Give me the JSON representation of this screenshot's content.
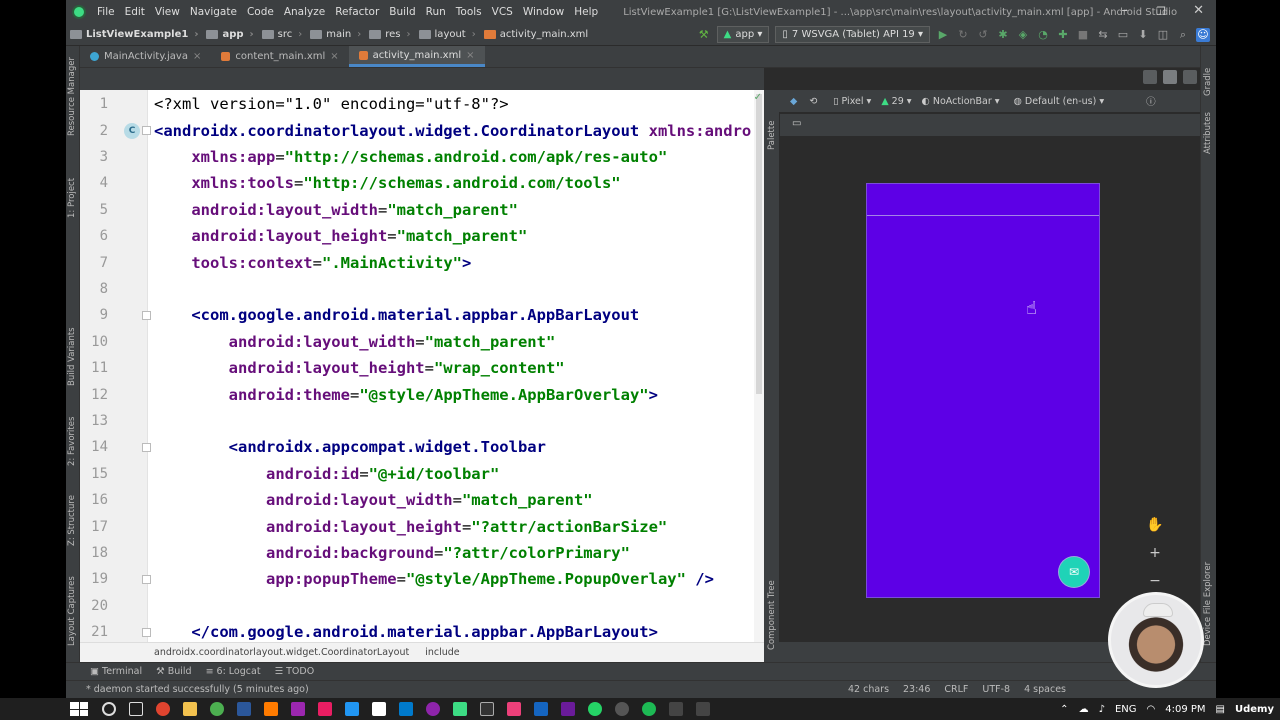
{
  "window": {
    "menu": [
      "File",
      "Edit",
      "View",
      "Navigate",
      "Code",
      "Analyze",
      "Refactor",
      "Build",
      "Run",
      "Tools",
      "VCS",
      "Window",
      "Help"
    ],
    "title": "ListViewExample1 [G:\\ListViewExample1] - ...\\app\\src\\main\\res\\layout\\activity_main.xml [app] - Android Studio",
    "controls": [
      "–",
      "❐",
      "✕"
    ]
  },
  "nav": {
    "breadcrumbs": [
      "ListViewExample1",
      "app",
      "src",
      "main",
      "res",
      "layout",
      "activity_main.xml"
    ],
    "run_config": "app",
    "device": "7  WSVGA (Tablet) API 19"
  },
  "tabs": [
    {
      "label": "MainActivity.java",
      "color": "#3ea6d3"
    },
    {
      "label": "content_main.xml",
      "color": "#e07b3a"
    },
    {
      "label": "activity_main.xml",
      "color": "#e07b3a",
      "active": true
    }
  ],
  "left_stripe": [
    "Resource Manager",
    "1: Project",
    "Build Variants",
    "2: Favorites",
    "Z: Structure",
    "Layout Captures"
  ],
  "right_stripe": [
    "Gradle",
    "Attributes",
    "Device File Explorer"
  ],
  "designer_stripe": [
    "Palette",
    "Component Tree"
  ],
  "code": [
    {
      "n": "1",
      "parts": [
        [
          "pi",
          "<?xml version=\"1.0\" encoding=\"utf-8\"?>"
        ]
      ]
    },
    {
      "n": "2",
      "mark": "C",
      "parts": [
        [
          "tag",
          "<androidx.coordinatorlayout.widget.CoordinatorLayout"
        ],
        [
          "pi",
          " "
        ],
        [
          "attr",
          "xmlns:andro"
        ]
      ]
    },
    {
      "n": "3",
      "parts": [
        [
          "pi",
          "    "
        ],
        [
          "attr",
          "xmlns:app"
        ],
        [
          "pi",
          "="
        ],
        [
          "val",
          "\"http://schemas.android.com/apk/res-auto\""
        ]
      ]
    },
    {
      "n": "4",
      "parts": [
        [
          "pi",
          "    "
        ],
        [
          "attr",
          "xmlns:tools"
        ],
        [
          "pi",
          "="
        ],
        [
          "val",
          "\"http://schemas.android.com/tools\""
        ]
      ]
    },
    {
      "n": "5",
      "parts": [
        [
          "pi",
          "    "
        ],
        [
          "attr",
          "android:layout_width"
        ],
        [
          "pi",
          "="
        ],
        [
          "val",
          "\"match_parent\""
        ]
      ]
    },
    {
      "n": "6",
      "parts": [
        [
          "pi",
          "    "
        ],
        [
          "attr",
          "android:layout_height"
        ],
        [
          "pi",
          "="
        ],
        [
          "val",
          "\"match_parent\""
        ]
      ]
    },
    {
      "n": "7",
      "parts": [
        [
          "pi",
          "    "
        ],
        [
          "attr",
          "tools:context"
        ],
        [
          "pi",
          "="
        ],
        [
          "val",
          "\".MainActivity\""
        ],
        [
          "tag",
          ">"
        ]
      ]
    },
    {
      "n": "8",
      "parts": []
    },
    {
      "n": "9",
      "parts": [
        [
          "pi",
          "    "
        ],
        [
          "tag",
          "<com.google.android.material.appbar.AppBarLayout"
        ]
      ]
    },
    {
      "n": "10",
      "parts": [
        [
          "pi",
          "        "
        ],
        [
          "attr",
          "android:layout_width"
        ],
        [
          "pi",
          "="
        ],
        [
          "val",
          "\"match_parent\""
        ]
      ]
    },
    {
      "n": "11",
      "parts": [
        [
          "pi",
          "        "
        ],
        [
          "attr",
          "android:layout_height"
        ],
        [
          "pi",
          "="
        ],
        [
          "val",
          "\"wrap_content\""
        ]
      ]
    },
    {
      "n": "12",
      "parts": [
        [
          "pi",
          "        "
        ],
        [
          "attr",
          "android:theme"
        ],
        [
          "pi",
          "="
        ],
        [
          "val",
          "\"@style/AppTheme.AppBarOverlay\""
        ],
        [
          "tag",
          ">"
        ]
      ]
    },
    {
      "n": "13",
      "parts": []
    },
    {
      "n": "14",
      "parts": [
        [
          "pi",
          "        "
        ],
        [
          "tag",
          "<androidx.appcompat.widget.Toolbar"
        ]
      ]
    },
    {
      "n": "15",
      "parts": [
        [
          "pi",
          "            "
        ],
        [
          "attr",
          "android:id"
        ],
        [
          "pi",
          "="
        ],
        [
          "val",
          "\"@+id/toolbar\""
        ]
      ]
    },
    {
      "n": "16",
      "parts": [
        [
          "pi",
          "            "
        ],
        [
          "attr",
          "android:layout_width"
        ],
        [
          "pi",
          "="
        ],
        [
          "val",
          "\"match_parent\""
        ]
      ]
    },
    {
      "n": "17",
      "parts": [
        [
          "pi",
          "            "
        ],
        [
          "attr",
          "android:layout_height"
        ],
        [
          "pi",
          "="
        ],
        [
          "val",
          "\"?attr/actionBarSize\""
        ]
      ]
    },
    {
      "n": "18",
      "parts": [
        [
          "pi",
          "            "
        ],
        [
          "attr",
          "android:background"
        ],
        [
          "pi",
          "="
        ],
        [
          "val",
          "\"?attr/colorPrimary\""
        ]
      ]
    },
    {
      "n": "19",
      "parts": [
        [
          "pi",
          "            "
        ],
        [
          "attr",
          "app:popupTheme"
        ],
        [
          "pi",
          "="
        ],
        [
          "val",
          "\"@style/AppTheme.PopupOverlay\""
        ],
        [
          "tag",
          " />"
        ]
      ]
    },
    {
      "n": "20",
      "parts": []
    },
    {
      "n": "21",
      "parts": [
        [
          "pi",
          "    "
        ],
        [
          "tag",
          "</com.google.android.material.appbar.AppBarLayout>"
        ]
      ]
    }
  ],
  "editor_breadcrumb": [
    "androidx.coordinatorlayout.widget.CoordinatorLayout",
    "include"
  ],
  "design_toolbar": {
    "device": "Pixel",
    "api": "29",
    "theme": "NoActionBar",
    "locale": "Default (en-us)"
  },
  "phone": {
    "primary_color": "#5d00e6",
    "fab_color": "#1fd3b7"
  },
  "bottom_tools": [
    "Terminal",
    "Build",
    "6: Logcat",
    "TODO"
  ],
  "status": {
    "message": "* daemon started successfully (5 minutes ago)",
    "chars": "42 chars",
    "position": "23:46",
    "line_sep": "CRLF",
    "encoding": "UTF-8",
    "indent": "4 spaces"
  },
  "taskbar": {
    "lang": "ENG",
    "time": "4:09 PM",
    "brand": "Udemy"
  }
}
